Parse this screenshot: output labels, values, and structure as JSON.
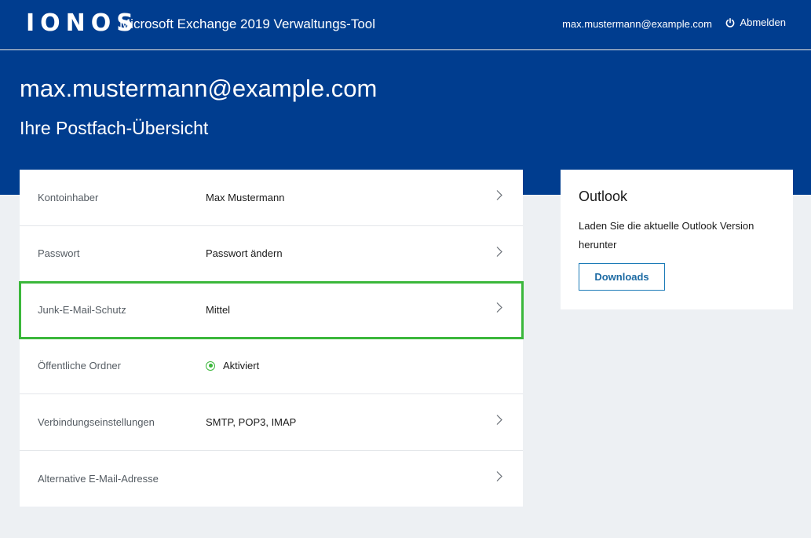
{
  "header": {
    "logo": "IONOS",
    "app_title": "Microsoft Exchange 2019 Verwaltungs-Tool",
    "user_email": "max.mustermann@example.com",
    "logout_label": "Abmelden",
    "logout_icon": "power-icon"
  },
  "hero": {
    "title": "max.mustermann@example.com",
    "subtitle": "Ihre Postfach-Übersicht"
  },
  "settings": {
    "rows": [
      {
        "label": "Kontoinhaber",
        "value": "Max Mustermann",
        "chevron": true
      },
      {
        "label": "Passwort",
        "value": "Passwort ändern",
        "chevron": true
      },
      {
        "label": "Junk-E-Mail-Schutz",
        "value": "Mittel",
        "chevron": true,
        "highlighted": true
      },
      {
        "label": "Öffentliche Ordner",
        "value": "Aktiviert",
        "status_icon": "radio-checked-icon"
      },
      {
        "label": "Verbindungseinstellungen",
        "value": "SMTP, POP3, IMAP",
        "chevron": true
      },
      {
        "label": "Alternative E-Mail-Adresse",
        "value": "",
        "chevron": true
      }
    ]
  },
  "outlook_card": {
    "title": "Outlook",
    "text": "Laden Sie die aktuelle Outlook Version herunter",
    "button_label": "Downloads"
  },
  "colors": {
    "brand_blue": "#003d8f",
    "highlight_green": "#3bb73b",
    "button_blue": "#1c7bb7",
    "background": "#edf0f3"
  }
}
